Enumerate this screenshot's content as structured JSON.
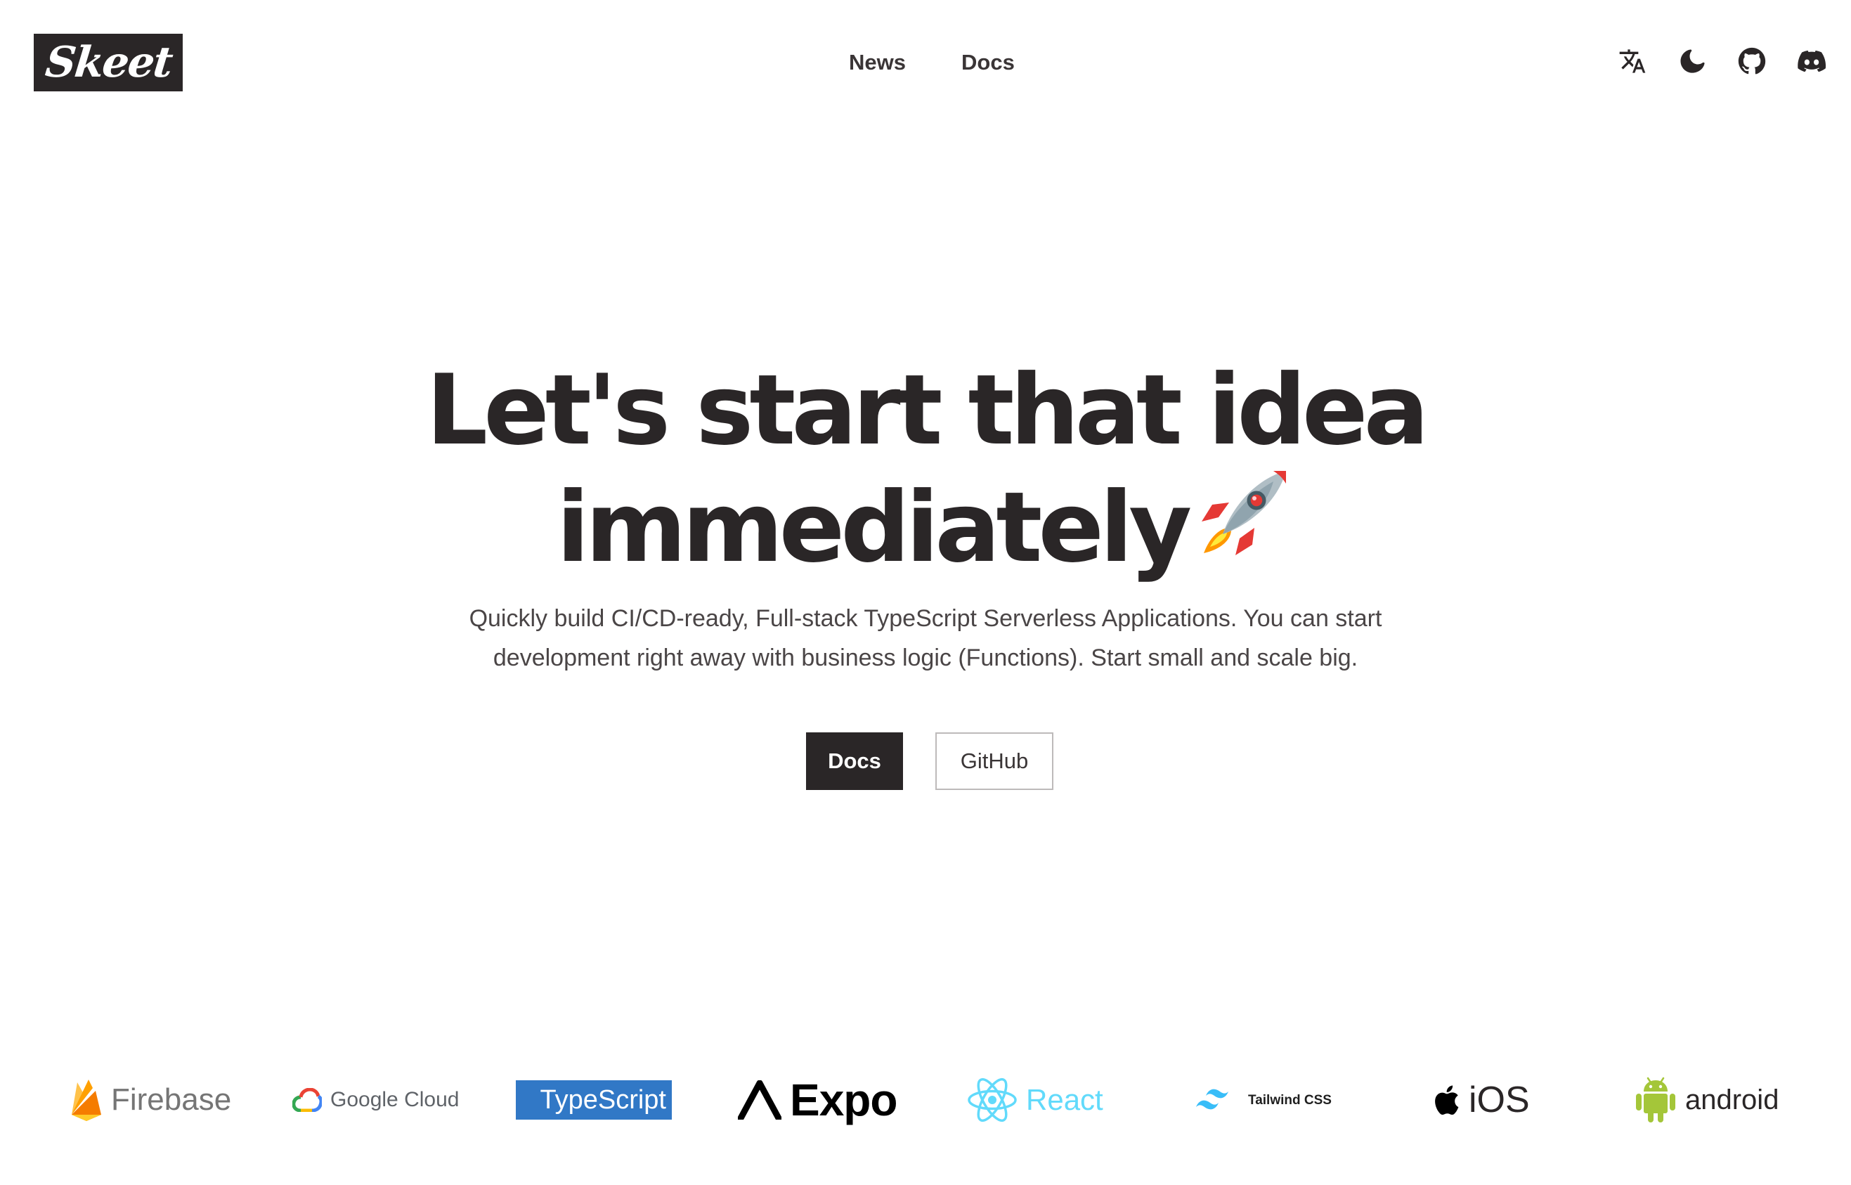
{
  "header": {
    "logo_text": "Skeet",
    "nav": [
      {
        "label": "News"
      },
      {
        "label": "Docs"
      }
    ],
    "icons": [
      "translate-icon",
      "dark-mode-moon-icon",
      "github-icon",
      "discord-icon"
    ]
  },
  "hero": {
    "title_line1": "Let's start that idea",
    "title_line2": "immediately",
    "title_emoji": "rocket-icon",
    "subtitle_line1": "Quickly build CI/CD-ready, Full-stack TypeScript Serverless Applications. You can start",
    "subtitle_line2": "development right away with business logic (Functions). Start small and scale big.",
    "primary_button": "Docs",
    "secondary_button": "GitHub"
  },
  "tech_stack": [
    {
      "name": "Firebase",
      "icon": "firebase-icon"
    },
    {
      "name": "Google Cloud",
      "part1": "Google",
      "part2": "Cloud",
      "icon": "google-cloud-icon"
    },
    {
      "name": "TypeScript",
      "part1": "Type",
      "part2": "Script"
    },
    {
      "name": "Expo",
      "icon": "expo-icon"
    },
    {
      "name": "React",
      "icon": "react-icon"
    },
    {
      "name": "Tailwind CSS",
      "icon": "tailwind-icon"
    },
    {
      "name": "iOS",
      "icon": "apple-icon"
    },
    {
      "name": "android",
      "icon": "android-icon"
    }
  ],
  "colors": {
    "text_dark": "#2a2627",
    "typescript_blue": "#3178c6",
    "react_cyan": "#61dafb",
    "tailwind_teal": "#38bdf8",
    "android_green": "#a4c639",
    "firebase_orange": "#ffa000"
  }
}
